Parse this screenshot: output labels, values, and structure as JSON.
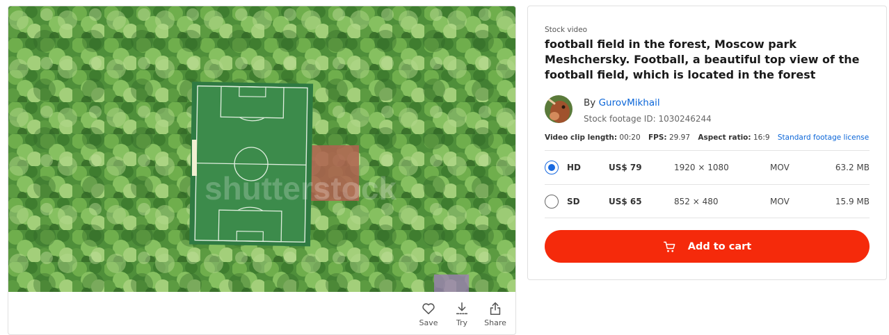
{
  "media": {
    "watermark": "shutterstock"
  },
  "actions": [
    {
      "label": "Save",
      "icon": "heart-icon"
    },
    {
      "label": "Try",
      "icon": "download-icon"
    },
    {
      "label": "Share",
      "icon": "share-icon"
    }
  ],
  "details": {
    "type_label": "Stock video",
    "title": "football field in the forest, Moscow park Meshchersky. Football, a beautiful top view of the football field, which is located in the forest",
    "by_prefix": "By",
    "author": "GurovMikhail",
    "stock_id": "Stock footage ID: 1030246244",
    "meta": {
      "length_label": "Video clip length:",
      "length_value": "00:20",
      "fps_label": "FPS:",
      "fps_value": "29.97",
      "aspect_label": "Aspect ratio:",
      "aspect_value": "16:9",
      "license_link": "Standard footage license"
    }
  },
  "options": [
    {
      "quality": "HD",
      "price": "US$ 79",
      "resolution": "1920 × 1080",
      "format": "MOV",
      "size": "63.2 MB",
      "selected": true
    },
    {
      "quality": "SD",
      "price": "US$ 65",
      "resolution": "852 × 480",
      "format": "MOV",
      "size": "15.9 MB",
      "selected": false
    }
  ],
  "cart": {
    "label": "Add to cart",
    "color": "#f52a0b"
  },
  "colors": {
    "accent": "#1769e0",
    "link": "#0a65d8"
  }
}
